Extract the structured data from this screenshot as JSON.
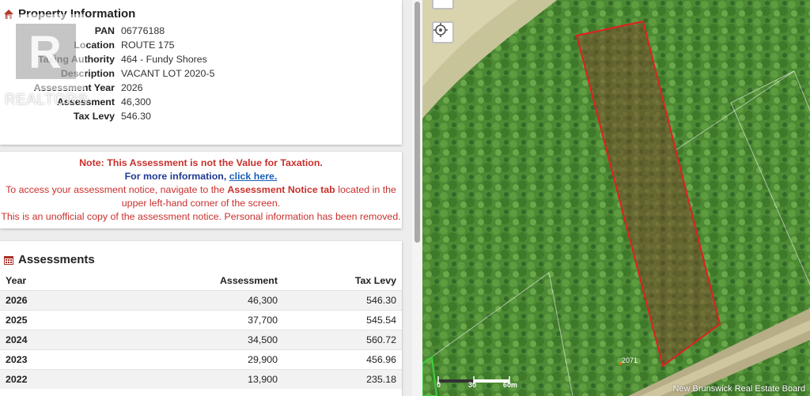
{
  "property": {
    "title": "Property Information",
    "rows": [
      {
        "label": "PAN",
        "value": "06776188"
      },
      {
        "label": "Location",
        "value": "ROUTE 175"
      },
      {
        "label": "Taxing Authority",
        "value": "464 - Fundy Shores"
      },
      {
        "label": "Description",
        "value": "VACANT LOT 2020-5"
      },
      {
        "label": "Assessment Year",
        "value": "2026"
      },
      {
        "label": "Assessment",
        "value": "46,300"
      },
      {
        "label": "Tax Levy",
        "value": "546.30"
      }
    ]
  },
  "note": {
    "line1": "Note: This Assessment is not the Value for Taxation.",
    "line2_prefix": "For more information, ",
    "line2_link": "click here.",
    "line3_prefix": "To access your assessment notice, navigate to the ",
    "line3_bold": "Assessment Notice tab",
    "line3_suffix": " located in the upper left-hand corner of the screen.",
    "line4": "This is an unofficial copy of the assessment notice. Personal information has been removed."
  },
  "assessments": {
    "title": "Assessments",
    "headers": {
      "year": "Year",
      "assessment": "Assessment",
      "levy": "Tax Levy"
    },
    "rows": [
      {
        "year": "2026",
        "assessment": "46,300",
        "levy": "546.30"
      },
      {
        "year": "2025",
        "assessment": "37,700",
        "levy": "545.54"
      },
      {
        "year": "2024",
        "assessment": "34,500",
        "levy": "560.72"
      },
      {
        "year": "2023",
        "assessment": "29,900",
        "levy": "456.96"
      },
      {
        "year": "2022",
        "assessment": "13,900",
        "levy": "235.18"
      }
    ]
  },
  "watermark": {
    "text": "REALTOR®"
  },
  "map": {
    "scale_labels": [
      "0",
      "30",
      "60m"
    ],
    "parcel_number": "2071",
    "credit": "New Brunswick Real Estate Board"
  },
  "colors": {
    "parcel_outline": "#e02020",
    "note_red": "#c9302c",
    "link_blue": "#1a5fb4"
  },
  "icons": {
    "property": "home-icon",
    "assessments": "calendar-icon",
    "map_locate": "crosshair-icon"
  }
}
